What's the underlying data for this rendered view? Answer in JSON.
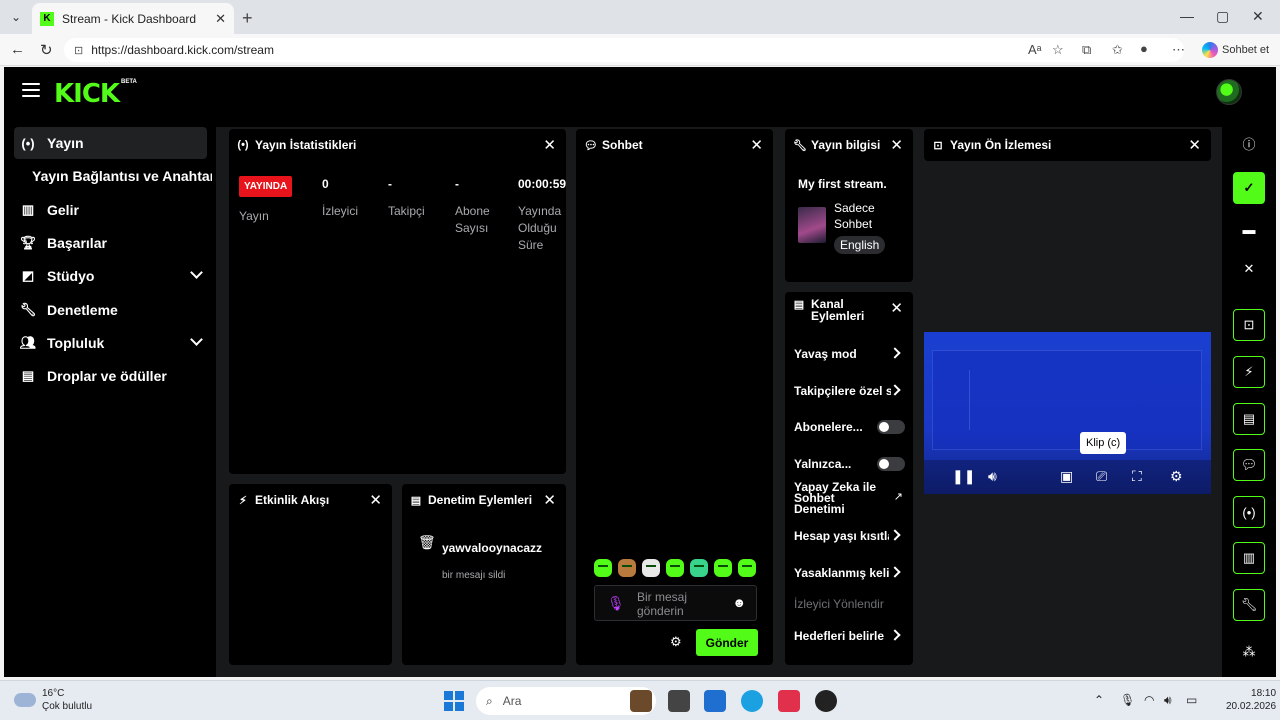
{
  "browser": {
    "tab_title": "Stream - Kick Dashboard",
    "favicon_letter": "K",
    "url": "https://dashboard.kick.com/stream",
    "copilot_label": "Sohbet et"
  },
  "app": {
    "logo": "KICK",
    "logo_badge": "BETA"
  },
  "sidebar": {
    "items": [
      {
        "label": "Yayın",
        "icon": "broadcast-icon",
        "active": true
      },
      {
        "label": "Yayın Bağlantısı ve Anahtarı",
        "sub": true
      },
      {
        "label": "Gelir",
        "icon": "chart-icon"
      },
      {
        "label": "Başarılar",
        "icon": "trophy-icon"
      },
      {
        "label": "Stüdyo",
        "icon": "studio-icon",
        "expandable": true
      },
      {
        "label": "Denetleme",
        "icon": "wrench-icon"
      },
      {
        "label": "Topluluk",
        "icon": "community-icon",
        "expandable": true
      },
      {
        "label": "Droplar ve ödüller",
        "icon": "gift-icon"
      }
    ]
  },
  "stats_panel": {
    "title": "Yayın İstatistikleri",
    "live_badge": "YAYINDA",
    "live_label": "Yayın",
    "viewers_value": "0",
    "viewers_label": "İzleyici",
    "followers_value": "-",
    "followers_label": "Takipçi",
    "subs_value": "-",
    "subs_label": "Abone Sayısı",
    "uptime_value": "00:00:59",
    "uptime_label": "Yayında Olduğu Süre"
  },
  "activity_panel": {
    "title": "Etkinlik Akışı"
  },
  "mod_panel": {
    "title": "Denetim Eylemleri",
    "entry_user": "yawvalooynacazz",
    "entry_action": "bir mesajı sildi"
  },
  "chat_panel": {
    "title": "Sohbet",
    "input_placeholder": "Bir mesaj gönderin",
    "send_label": "Gönder"
  },
  "stream_info_panel": {
    "title": "Yayın bilgisi",
    "stream_title": "My first stream.",
    "category": "Sadece Sohbet",
    "language_tag": "English"
  },
  "channel_actions_panel": {
    "title": "Kanal Eylemleri",
    "rows": [
      {
        "label": "Yavaş mod",
        "control": "arrow"
      },
      {
        "label": "Takipçilere özel sohbet",
        "control": "arrow"
      },
      {
        "label": "Abonelere...",
        "control": "toggle"
      },
      {
        "label": "Yalnızca...",
        "control": "toggle"
      },
      {
        "label": "Yapay Zeka ile Sohbet Denetimi",
        "control": "external"
      },
      {
        "label": "Hesap yaşı kısıtlaması",
        "control": "arrow"
      },
      {
        "label": "Yasaklanmış kelimeler",
        "control": "arrow"
      },
      {
        "label": "İzleyici Yönlendir",
        "control": "none",
        "disabled": true
      },
      {
        "label": "Hedefleri belirle",
        "control": "arrow"
      }
    ]
  },
  "preview_panel": {
    "title": "Yayın Ön İzlemesi",
    "tooltip": "Klip (c)"
  },
  "taskbar": {
    "temperature": "16°C",
    "weather": "Çok bulutlu",
    "search_placeholder": "Ara",
    "time": "18:10",
    "date": "20.02.2026"
  },
  "colors": {
    "kick_green": "#53fc18",
    "live_red": "#e9141b",
    "panel_bg": "#000000",
    "workspace_bg": "#18191b"
  }
}
